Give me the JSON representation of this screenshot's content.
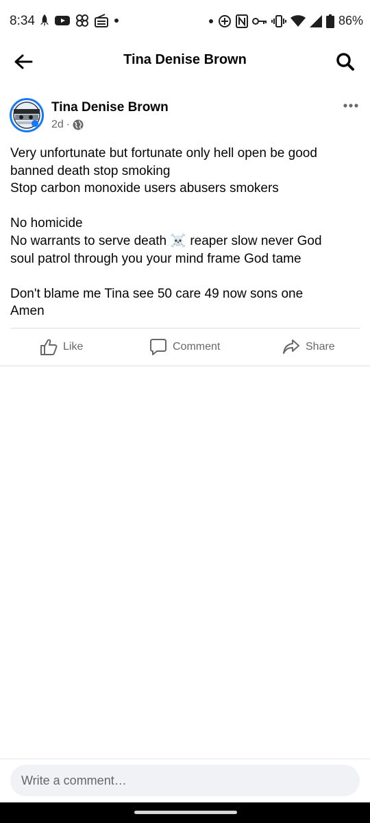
{
  "status_bar": {
    "time": "8:34",
    "battery": "86%",
    "left_icons": [
      "rocket-icon",
      "youtube-icon",
      "pinwheel-icon",
      "radio-icon",
      "dot-icon"
    ],
    "right_icons": [
      "dot-icon",
      "data-saver-icon",
      "nfc-icon",
      "key-icon",
      "vibrate-icon",
      "wifi-icon",
      "signal-icon",
      "battery-icon"
    ]
  },
  "header": {
    "title": "Tina Denise Brown"
  },
  "post": {
    "author": "Tina Denise Brown",
    "time_ago": "2d",
    "separator": "·",
    "privacy": "globe-icon",
    "lines": [
      "Very unfortunate but fortunate only hell open be good",
      "banned death stop smoking",
      "Stop carbon monoxide users abusers smokers",
      "",
      "No homicide",
      "No warrants to serve death ☠️ reaper slow never God",
      "soul patrol through you your mind frame God tame",
      "",
      "Don't blame me Tina see 50 care 49 now sons one",
      "Amen"
    ]
  },
  "actions": {
    "like": "Like",
    "comment": "Comment",
    "share": "Share"
  },
  "composer": {
    "placeholder": "Write a comment…"
  },
  "colors": {
    "accent": "#1877f2",
    "secondary_text": "#65676b",
    "divider": "#dadde1"
  }
}
